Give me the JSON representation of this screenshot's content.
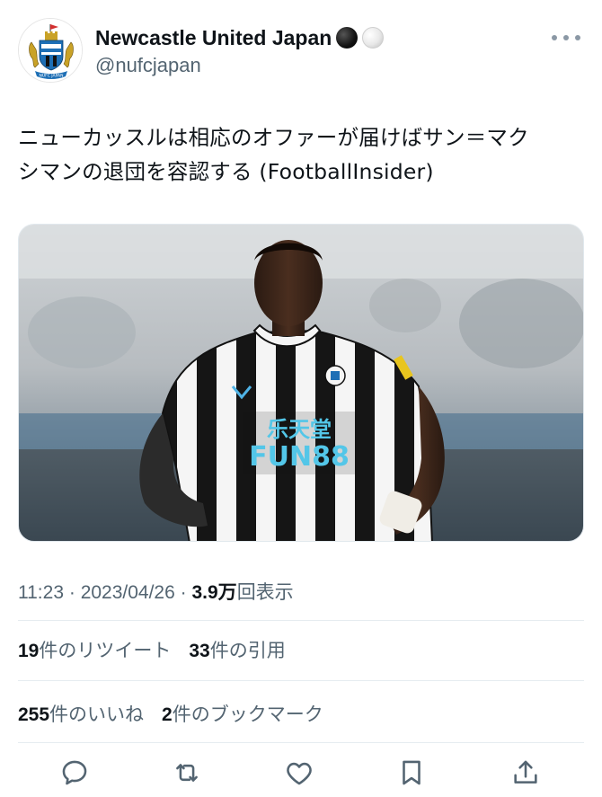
{
  "account": {
    "display_name": "Newcastle United Japan",
    "handle": "@nufcjapan",
    "avatar_icon": "newcastle-crest",
    "name_emoji": [
      "black-circle",
      "white-circle"
    ]
  },
  "tweet": {
    "text_line1": "ニューカッスルは相応のオファーが届けばサン＝マク",
    "text_line2": "シマンの退団を容認する (FootballInsider)"
  },
  "media": {
    "type": "photo",
    "shirt_sponsor_line1": "乐天堂",
    "shirt_sponsor_line2": "FUN88"
  },
  "meta": {
    "time": "11:23",
    "separator": "·",
    "date": "2023/04/26",
    "views_count": "3.9万",
    "views_label": "回表示"
  },
  "stats": {
    "retweets_count": "19",
    "retweets_label": "件のリツイート",
    "quotes_count": "33",
    "quotes_label": "件の引用",
    "likes_count": "255",
    "likes_label": "件のいいね",
    "bookmarks_count": "2",
    "bookmarks_label": "件のブックマーク"
  },
  "actions": [
    "reply-icon",
    "retweet-icon",
    "like-icon",
    "bookmark-icon",
    "share-icon"
  ],
  "colors": {
    "text_primary": "#0f1419",
    "text_secondary": "#536471",
    "divider": "#e6ecf0"
  }
}
